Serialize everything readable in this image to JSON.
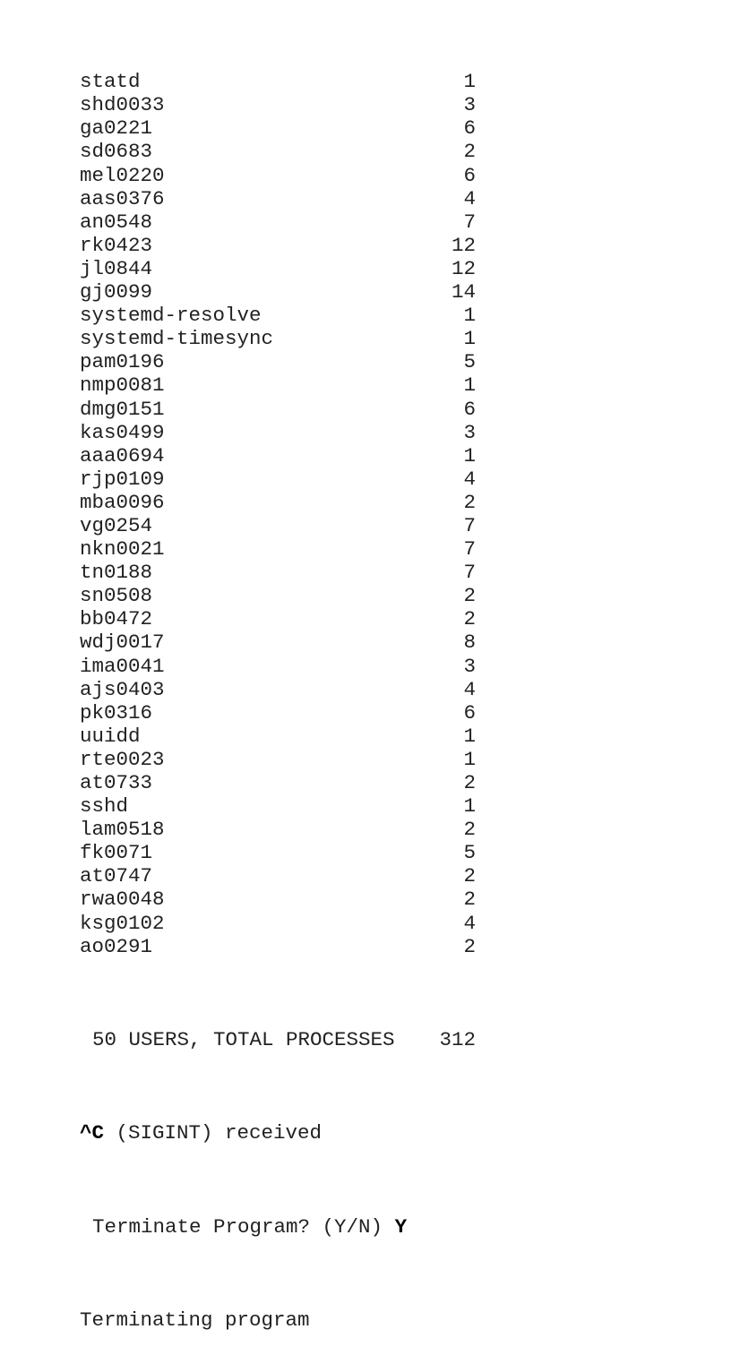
{
  "processes": [
    {
      "user": "statd",
      "count": "1"
    },
    {
      "user": "shd0033",
      "count": "3"
    },
    {
      "user": "ga0221",
      "count": "6"
    },
    {
      "user": "sd0683",
      "count": "2"
    },
    {
      "user": "mel0220",
      "count": "6"
    },
    {
      "user": "aas0376",
      "count": "4"
    },
    {
      "user": "an0548",
      "count": "7"
    },
    {
      "user": "rk0423",
      "count": "12"
    },
    {
      "user": "jl0844",
      "count": "12"
    },
    {
      "user": "gj0099",
      "count": "14"
    },
    {
      "user": "systemd-resolve",
      "count": "1"
    },
    {
      "user": "systemd-timesync",
      "count": "1"
    },
    {
      "user": "pam0196",
      "count": "5"
    },
    {
      "user": "nmp0081",
      "count": "1"
    },
    {
      "user": "dmg0151",
      "count": "6"
    },
    {
      "user": "kas0499",
      "count": "3"
    },
    {
      "user": "aaa0694",
      "count": "1"
    },
    {
      "user": "rjp0109",
      "count": "4"
    },
    {
      "user": "mba0096",
      "count": "2"
    },
    {
      "user": "vg0254",
      "count": "7"
    },
    {
      "user": "nkn0021",
      "count": "7"
    },
    {
      "user": "tn0188",
      "count": "7"
    },
    {
      "user": "sn0508",
      "count": "2"
    },
    {
      "user": "bb0472",
      "count": "2"
    },
    {
      "user": "wdj0017",
      "count": "8"
    },
    {
      "user": "ima0041",
      "count": "3"
    },
    {
      "user": "ajs0403",
      "count": "4"
    },
    {
      "user": "pk0316",
      "count": "6"
    },
    {
      "user": "uuidd",
      "count": "1"
    },
    {
      "user": "rte0023",
      "count": "1"
    },
    {
      "user": "at0733",
      "count": "2"
    },
    {
      "user": "sshd",
      "count": "1"
    },
    {
      "user": "lam0518",
      "count": "2"
    },
    {
      "user": "fk0071",
      "count": "5"
    },
    {
      "user": "at0747",
      "count": "2"
    },
    {
      "user": "rwa0048",
      "count": "2"
    },
    {
      "user": "ksg0102",
      "count": "4"
    },
    {
      "user": "ao0291",
      "count": "2"
    }
  ],
  "summary": {
    "label": "50 USERS, TOTAL PROCESSES",
    "total": "312"
  },
  "signal": {
    "keys": "^C",
    "message": " (SIGINT) received"
  },
  "prompt": {
    "question": "Terminate Program? (Y/N) ",
    "answer": "Y"
  },
  "status": "Terminating program"
}
